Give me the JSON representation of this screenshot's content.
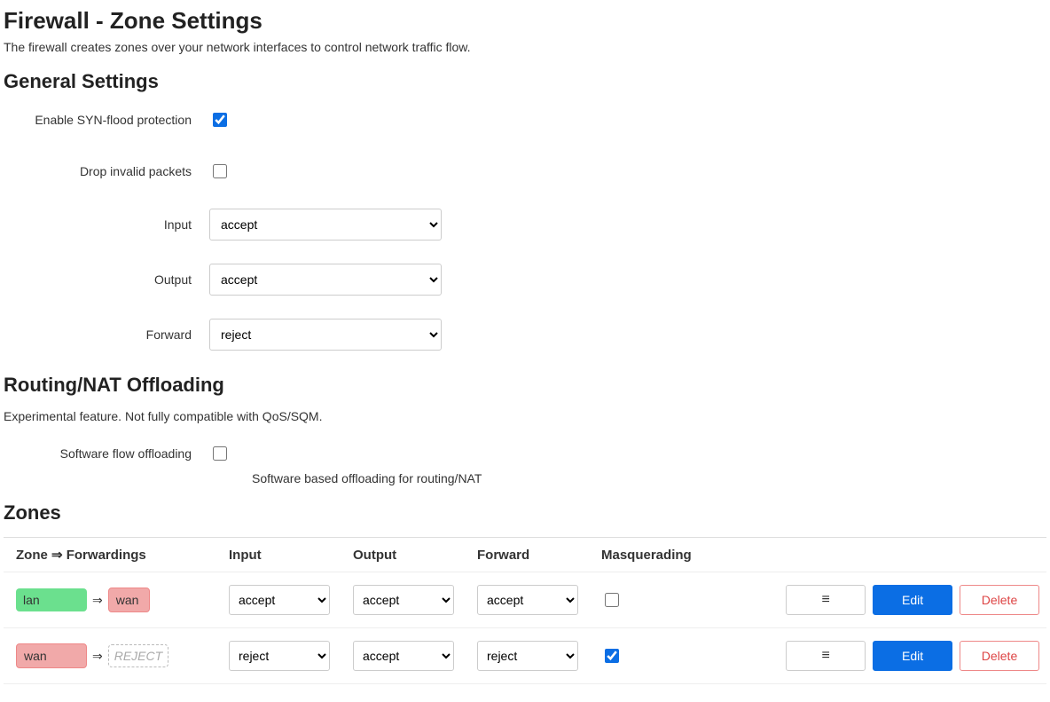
{
  "page": {
    "title": "Firewall - Zone Settings",
    "description": "The firewall creates zones over your network interfaces to control network traffic flow."
  },
  "general": {
    "heading": "General Settings",
    "syn_flood_label": "Enable SYN-flood protection",
    "syn_flood_checked": true,
    "drop_invalid_label": "Drop invalid packets",
    "drop_invalid_checked": false,
    "input_label": "Input",
    "input_value": "accept",
    "output_label": "Output",
    "output_value": "accept",
    "forward_label": "Forward",
    "forward_value": "reject"
  },
  "offloading": {
    "heading": "Routing/NAT Offloading",
    "description": "Experimental feature. Not fully compatible with QoS/SQM.",
    "software_label": "Software flow offloading",
    "software_checked": false,
    "software_help": "Software based offloading for routing/NAT"
  },
  "zones": {
    "heading": "Zones",
    "col_zone": "Zone ⇒ Forwardings",
    "col_input": "Input",
    "col_output": "Output",
    "col_forward": "Forward",
    "col_masq": "Masquerading",
    "edit_label": "Edit",
    "delete_label": "Delete",
    "drag_glyph": "≡",
    "arrow_glyph": "⇒",
    "rows": [
      {
        "src_name": "lan",
        "src_class": "badge-lan",
        "dst_name": "wan",
        "dst_class": "badge-wan",
        "input": "accept",
        "output": "accept",
        "forward": "accept",
        "masq": false
      },
      {
        "src_name": "wan",
        "src_class": "badge-wan-src",
        "dst_name": "REJECT",
        "dst_class": "badge-reject",
        "input": "reject",
        "output": "accept",
        "forward": "reject",
        "masq": true
      }
    ]
  }
}
